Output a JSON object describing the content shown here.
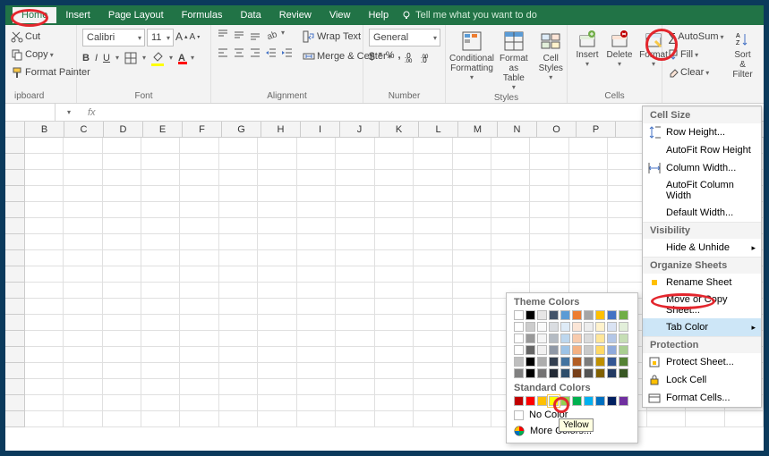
{
  "tabs": [
    "Home",
    "Insert",
    "Page Layout",
    "Formulas",
    "Data",
    "Review",
    "View",
    "Help"
  ],
  "active_tab": "Home",
  "tell_me": "Tell me what you want to do",
  "clipboard": {
    "cut": "Cut",
    "copy": "Copy",
    "painter": "Format Painter",
    "label": "ipboard"
  },
  "font": {
    "name": "Calibri",
    "size": "11",
    "label": "Font"
  },
  "alignment": {
    "wrap": "Wrap Text",
    "merge": "Merge & Center",
    "label": "Alignment"
  },
  "number": {
    "format": "General",
    "label": "Number"
  },
  "styles": {
    "cond": "Conditional Formatting",
    "fmtas": "Format as Table",
    "cellst": "Cell Styles",
    "label": "Styles"
  },
  "cells": {
    "insert": "Insert",
    "delete": "Delete",
    "format": "Format",
    "label": "Cells"
  },
  "editing": {
    "autosum": "AutoSum",
    "fill": "Fill",
    "clear": "Clear",
    "sort": "Sort & Filter"
  },
  "namebox": "",
  "columns": [
    "B",
    "C",
    "D",
    "E",
    "F",
    "G",
    "H",
    "I",
    "J",
    "K",
    "L",
    "M",
    "N",
    "O",
    "P"
  ],
  "menu": {
    "cell_size": "Cell Size",
    "row_height": "Row Height...",
    "autofit_row": "AutoFit Row Height",
    "col_width": "Column Width...",
    "autofit_col": "AutoFit Column Width",
    "default_width": "Default Width...",
    "visibility": "Visibility",
    "hide_unhide": "Hide & Unhide",
    "organize": "Organize Sheets",
    "rename": "Rename Sheet",
    "move_copy": "Move or Copy Sheet...",
    "tab_color": "Tab Color",
    "protection": "Protection",
    "protect": "Protect Sheet...",
    "lock": "Lock Cell",
    "format_cells": "Format Cells..."
  },
  "color_flyout": {
    "theme": "Theme Colors",
    "standard": "Standard Colors",
    "no_color": "No Color",
    "more": "More Colors...",
    "theme_row": [
      "#ffffff",
      "#000000",
      "#e7e6e6",
      "#44546a",
      "#5b9bd5",
      "#ed7d31",
      "#a5a5a5",
      "#ffc000",
      "#4472c4",
      "#70ad47"
    ],
    "standard_row": [
      "#c00000",
      "#ff0000",
      "#ffc000",
      "#ffff00",
      "#92d050",
      "#00b050",
      "#00b0f0",
      "#0070c0",
      "#002060",
      "#7030a0"
    ]
  },
  "tooltip": "Yellow"
}
